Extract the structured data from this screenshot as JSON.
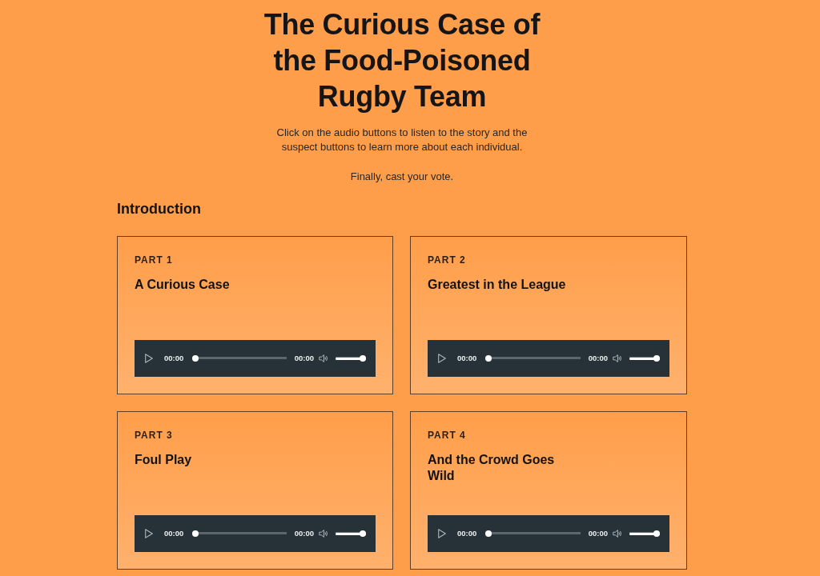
{
  "page": {
    "title": "The Curious Case of the Food-Poisoned Rugby Team",
    "intro": [
      "Click on the audio buttons to listen to the story and the suspect buttons to learn more about each individual.",
      "Finally, cast your vote."
    ]
  },
  "section": {
    "heading": "Introduction",
    "parts": [
      {
        "label": "PART 1",
        "title": "A Curious Case",
        "player": {
          "current_time": "00:00",
          "duration": "00:00",
          "progress": {
            "level": 0
          },
          "volume": {
            "level": 1
          }
        }
      },
      {
        "label": "PART 2",
        "title": "Greatest in the League",
        "player": {
          "current_time": "00:00",
          "duration": "00:00",
          "progress": {
            "level": 0
          },
          "volume": {
            "level": 1
          }
        }
      },
      {
        "label": "PART 3",
        "title": "Foul Play",
        "player": {
          "current_time": "00:00",
          "duration": "00:00",
          "progress": {
            "level": 0
          },
          "volume": {
            "level": 1
          }
        }
      },
      {
        "label": "PART 4",
        "title": "And the Crowd Goes Wild",
        "player": {
          "current_time": "00:00",
          "duration": "00:00",
          "progress": {
            "level": 0
          },
          "volume": {
            "level": 1
          }
        }
      }
    ]
  }
}
